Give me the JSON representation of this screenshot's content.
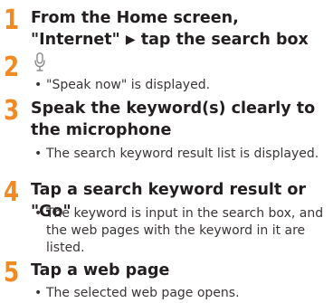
{
  "steps": [
    {
      "number": "1",
      "title_part1": "From the Home screen, \"Internet\" ",
      "arrow": "▶",
      "title_part2": " tap the search box"
    },
    {
      "number": "2",
      "icon": "microphone-icon",
      "bullet": "\"Speak now\" is displayed."
    },
    {
      "number": "3",
      "title": "Speak the keyword(s) clearly to the microphone",
      "bullet": "The search keyword result list is displayed."
    },
    {
      "number": "4",
      "title": "Tap a search keyword result or \"Go\"",
      "bullet": "The keyword is input in the search box, and the web pages with the keyword in it are listed."
    },
    {
      "number": "5",
      "title": "Tap a web page",
      "bullet": "The selected web page opens."
    }
  ],
  "bullet_symbol": "•",
  "colors": {
    "step_number": "#f08a24",
    "title_text": "#231f20",
    "body_text": "#3a3536"
  }
}
